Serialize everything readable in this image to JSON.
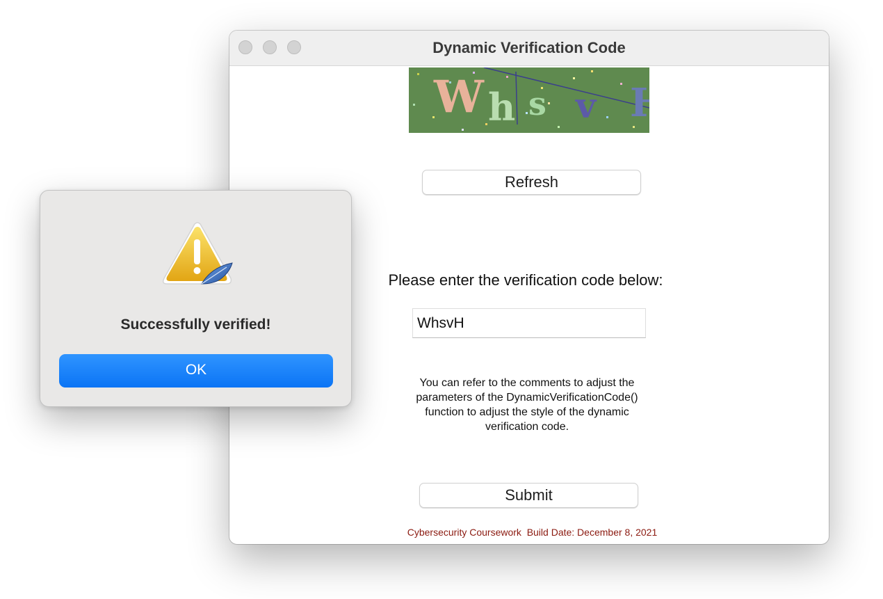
{
  "window": {
    "title": "Dynamic Verification Code",
    "traffic_lights": [
      "close-button",
      "minimize-button",
      "zoom-button"
    ]
  },
  "captcha": {
    "characters": [
      "W",
      "h",
      "s",
      "v",
      "H"
    ],
    "char_colors": [
      "#e8b29a",
      "#b9ddb0",
      "#a9d8a4",
      "#5c5aa8",
      "#6a7bb4"
    ],
    "background_color": "#5f8a4f"
  },
  "refresh_button": {
    "label": "Refresh"
  },
  "prompt": {
    "label": "Please enter the verification code below:"
  },
  "code_input": {
    "value": "WhsvH"
  },
  "help": {
    "lines": [
      "You can refer to the comments to adjust the",
      "parameters of the DynamicVerificationCode()",
      "function to adjust the style of the dynamic",
      "verification code."
    ]
  },
  "submit_button": {
    "label": "Submit"
  },
  "footer": {
    "text": "Cybersecurity Coursework  Build Date: December 8, 2021"
  },
  "alert": {
    "icon": "warning-icon",
    "message": "Successfully verified!",
    "ok_label": "OK",
    "ok_color": "#1a82fb"
  }
}
